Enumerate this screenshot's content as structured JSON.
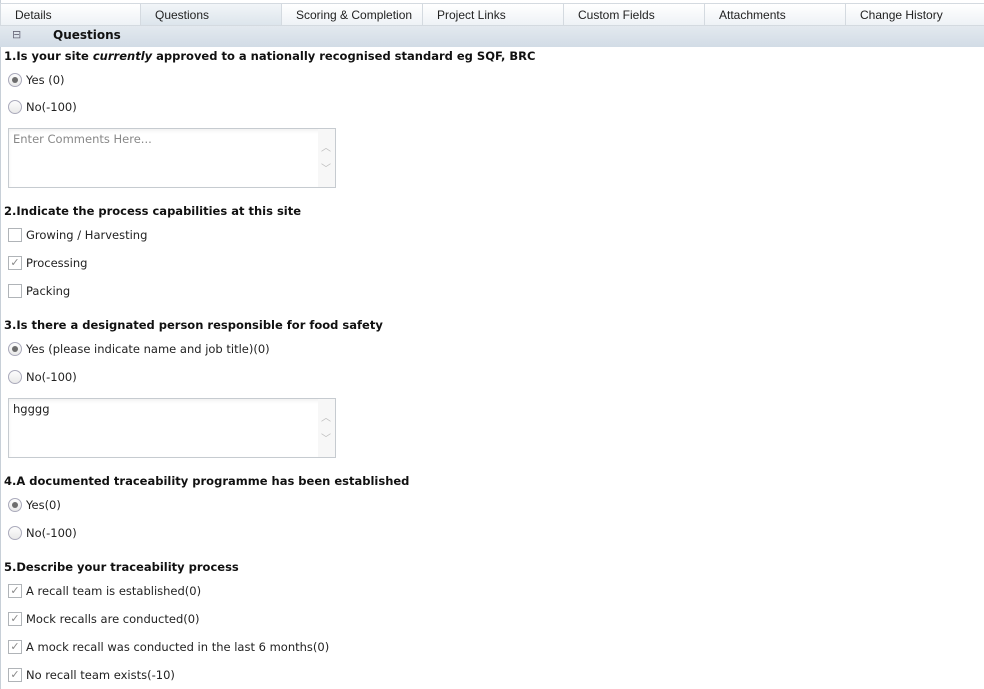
{
  "tabs": [
    {
      "label": "Details",
      "active": false
    },
    {
      "label": "Questions",
      "active": true
    },
    {
      "label": "Scoring & Completion",
      "active": false
    },
    {
      "label": "Project Links",
      "active": false
    },
    {
      "label": "Custom Fields",
      "active": false
    },
    {
      "label": "Attachments",
      "active": false
    },
    {
      "label": "Change History",
      "active": false
    }
  ],
  "section": {
    "title": "Questions",
    "collapse_icon": "collapse-minus-icon"
  },
  "questions": [
    {
      "number": "1.",
      "text_before": "Is your site ",
      "text_em": "currently",
      "text_after": " approved to a nationally recognised standard eg SQF, BRC",
      "type": "radio",
      "options": [
        {
          "label": "Yes (0)",
          "selected": true
        },
        {
          "label": "No(-100)",
          "selected": false
        }
      ],
      "comment": {
        "value": "",
        "placeholder": "Enter Comments Here..."
      }
    },
    {
      "number": "2.",
      "text": "Indicate the process capabilities at this site",
      "type": "checkbox",
      "options": [
        {
          "label": "Growing / Harvesting",
          "checked": false
        },
        {
          "label": "Processing",
          "checked": true
        },
        {
          "label": "Packing",
          "checked": false
        }
      ]
    },
    {
      "number": "3.",
      "text": "Is there a designated person responsible for food safety",
      "type": "radio",
      "options": [
        {
          "label": "Yes (please indicate name and job title)(0)",
          "selected": true
        },
        {
          "label": "No(-100)",
          "selected": false
        }
      ],
      "comment": {
        "value": "hgggg",
        "placeholder": "Enter Comments Here..."
      }
    },
    {
      "number": "4.",
      "text": "A documented traceability programme has been established",
      "type": "radio",
      "options": [
        {
          "label": "Yes(0)",
          "selected": true
        },
        {
          "label": "No(-100)",
          "selected": false
        }
      ]
    },
    {
      "number": "5.",
      "text": "Describe your traceability process",
      "type": "checkbox",
      "options": [
        {
          "label": "A recall team is established(0)",
          "checked": true
        },
        {
          "label": "Mock recalls are conducted(0)",
          "checked": true
        },
        {
          "label": "A mock recall was conducted in the last 6 months(0)",
          "checked": true
        },
        {
          "label": "No recall team exists(-10)",
          "checked": true
        }
      ]
    }
  ],
  "icons": {
    "check": "✓",
    "scroll_up": "︿",
    "scroll_down": "﹀",
    "collapse": "⊟"
  },
  "colors": {
    "section_bar": "#d8e1ea",
    "border": "#c6cbd0"
  }
}
